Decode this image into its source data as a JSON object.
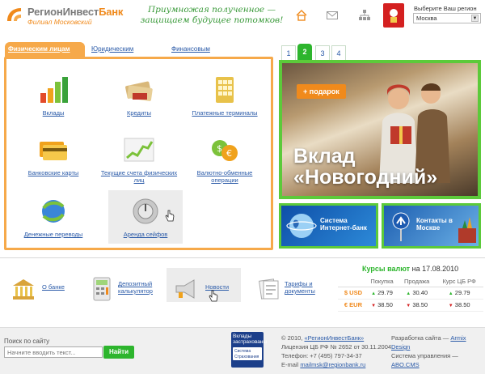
{
  "header": {
    "logo_main": "РегионИнвест",
    "logo_accent": "Банк",
    "logo_sub": "Филиал Московский",
    "slogan": "Приумножая полученное — защищаем будущее потомков!",
    "region_label": "Выберите Ваш регион",
    "region_value": "Москва"
  },
  "tabs": [
    {
      "label": "Физическим лицам",
      "active": true
    },
    {
      "label": "Юридическим лицам",
      "active": false
    },
    {
      "label": "Финансовым организациям",
      "active": false
    }
  ],
  "services": [
    {
      "label": "Вклады",
      "icon": "bar-chart-icon"
    },
    {
      "label": "Кредиты",
      "icon": "money-icon"
    },
    {
      "label": "Платежные терминалы",
      "icon": "terminal-keypad-icon"
    },
    {
      "label": "Банковские карты",
      "icon": "bank-cards-icon"
    },
    {
      "label": "Текущие счета физических лиц",
      "icon": "growth-chart-icon"
    },
    {
      "label": "Валютно-обменные операции",
      "icon": "currency-exchange-icon"
    },
    {
      "label": "Денежные переводы",
      "icon": "globe-arrows-icon"
    },
    {
      "label": "Аренда сейфов",
      "icon": "safe-dial-icon"
    }
  ],
  "promo": {
    "pages": [
      "1",
      "2",
      "3",
      "4"
    ],
    "active_page": "2",
    "badge": "+ подарок",
    "title_line1": "Вклад",
    "title_line2": "«Новогодний»"
  },
  "banners": {
    "internet_bank": "Система Интернет-банк",
    "contacts": "Контакты в Москве"
  },
  "bottom_links": [
    {
      "label": "О банке",
      "icon": "bank-building-icon"
    },
    {
      "label": "Депозитный калькулятор",
      "icon": "calculator-icon"
    },
    {
      "label": "Новости",
      "icon": "megaphone-icon"
    },
    {
      "label": "Тарифы и документы",
      "icon": "documents-icon"
    }
  ],
  "rates": {
    "title": "Курсы валют",
    "date_prefix": "на",
    "date": "17.08.2010",
    "columns": [
      "Покупка",
      "Продажа",
      "Курс ЦБ РФ"
    ],
    "rows": [
      {
        "symbol": "$",
        "currency": "USD",
        "buy": "29.79",
        "buy_dir": "up",
        "sell": "30.40",
        "sell_dir": "up",
        "cb": "29.79",
        "cb_dir": "up"
      },
      {
        "symbol": "€",
        "currency": "EUR",
        "buy": "38.50",
        "buy_dir": "down",
        "sell": "38.50",
        "sell_dir": "down",
        "cb": "38.50",
        "cb_dir": "down"
      }
    ]
  },
  "footer": {
    "search_label": "Поиск по сайту",
    "search_placeholder": "Начните вводить текст...",
    "search_button": "Найти",
    "insurance_title": "Вклады застрахованы",
    "insurance_sub": "Система Страхования Вкладов",
    "copyright": "© 2010,",
    "bank_link": "«РегионИнвестБанк»",
    "license": "Лицензия ЦБ РФ № 2652 от 30.11.2004",
    "phone": "Телефон: +7 (495) 797-34-37",
    "email_label": "E-mail",
    "email": "mailmsk@regionbank.ru",
    "dev_label": "Разработка сайта —",
    "dev_link": "Armix Design",
    "cms_label": "Система управления —",
    "cms_link": "ABO.CMS"
  }
}
